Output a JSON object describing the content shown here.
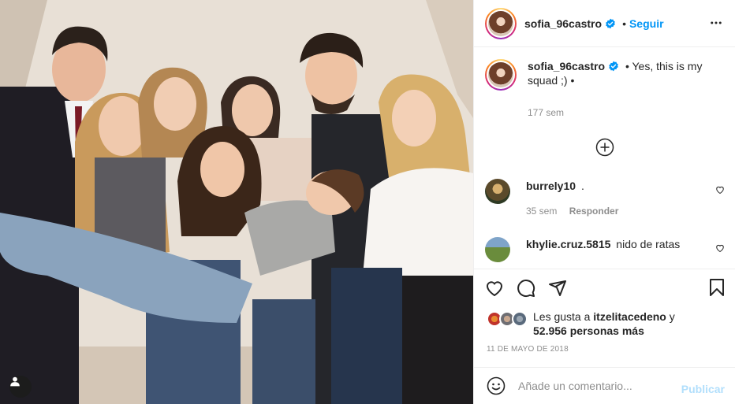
{
  "post": {
    "author": "sofia_96castro",
    "follow_label": "Seguir",
    "separator": "•",
    "caption": "Yes, this is my squad ;) •",
    "caption_time": "177 sem",
    "comments": [
      {
        "user": "burrely10",
        "text": ".",
        "time": "35 sem",
        "reply_label": "Responder"
      },
      {
        "user": "khylie.cruz.5815",
        "text": "nido de ratas"
      }
    ],
    "likes": {
      "prefix": "Les gusta a",
      "user": "itzelitacedeno",
      "connector": "y",
      "count": "52.956 personas más"
    },
    "date": "11 DE MAYO DE 2018",
    "comment_placeholder": "Añade un comentario...",
    "publish_label": "Publicar"
  },
  "icons": {
    "more": "more-horizontal-icon",
    "verified": "verified-badge-icon",
    "load_more": "plus-circle-icon",
    "like": "heart-icon",
    "comment": "comment-bubble-icon",
    "share": "paper-plane-icon",
    "save": "bookmark-icon",
    "emoji": "smiley-icon",
    "tag": "user-tag-icon"
  },
  "colors": {
    "accent": "#0095f6",
    "publish_disabled": "#b2dffc",
    "secondary_text": "#8e8e8e",
    "border": "#efefef"
  }
}
